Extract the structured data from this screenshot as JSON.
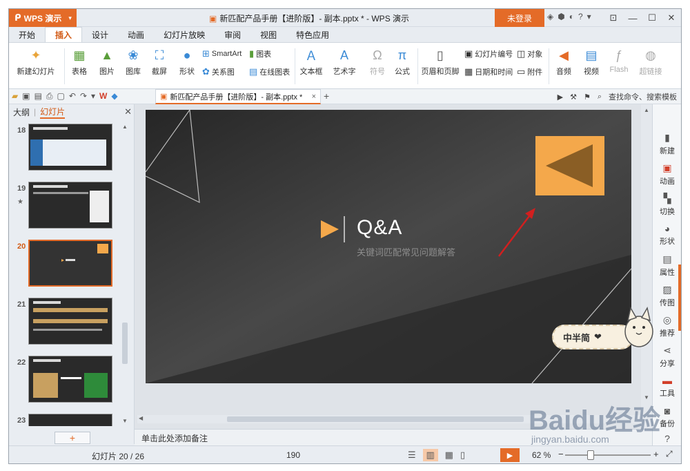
{
  "window": {
    "app_name": "WPS 演示",
    "doc_title": "新匹配产品手册【进阶版】- 副本.pptx * - WPS 演示",
    "login_label": "未登录"
  },
  "ribbon_tabs": [
    "开始",
    "插入",
    "设计",
    "动画",
    "幻灯片放映",
    "审阅",
    "视图",
    "特色应用"
  ],
  "ribbon": {
    "new_slide": "新建幻灯片",
    "table": "表格",
    "picture": "图片",
    "gallery": "图库",
    "screenshot": "截屏",
    "shape": "形状",
    "smartart": "SmartArt",
    "chart": "图表",
    "relation": "关系图",
    "online_chart": "在线图表",
    "textbox": "文本框",
    "wordart": "艺术字",
    "symbol": "符号",
    "formula": "公式",
    "header_footer": "页眉和页脚",
    "slide_number": "幻灯片编号",
    "date_time": "日期和时间",
    "object": "对象",
    "attachment": "附件",
    "audio": "音频",
    "video": "视频",
    "flash": "Flash",
    "hyperlink": "超链接"
  },
  "doc_tab": {
    "label": "新匹配产品手册【进阶版】- 副本.pptx *",
    "close": "×"
  },
  "quick_right": {
    "search_label": "查找命令、搜索模板"
  },
  "left_panel": {
    "tab_outline": "大纲",
    "tab_slides": "幻灯片",
    "thumbs": [
      {
        "num": "18"
      },
      {
        "num": "19"
      },
      {
        "num": "20"
      },
      {
        "num": "21"
      },
      {
        "num": "22"
      },
      {
        "num": "23"
      }
    ],
    "add_button": "+"
  },
  "slide": {
    "title": "Q&A",
    "subtitle": "关键词匹配常见问题解答"
  },
  "notes_placeholder": "单击此处添加备注",
  "right_pane": [
    "新建",
    "动画",
    "切换",
    "形状",
    "属性",
    "传图",
    "推荐",
    "分享",
    "工具",
    "备份",
    "帮助"
  ],
  "status": {
    "slide_info": "幻灯片 20 / 26",
    "mid_value": "190",
    "zoom": "62 %"
  },
  "overlay": {
    "badge": "中半简",
    "watermark_word": "Baidu经验",
    "watermark_url": "jingyan.baidu.com"
  },
  "colors": {
    "accent": "#e46b28",
    "slide_bg": "#3a3a3a",
    "arrow_red": "#d11f1f",
    "qa_orange": "#f4a84b"
  }
}
